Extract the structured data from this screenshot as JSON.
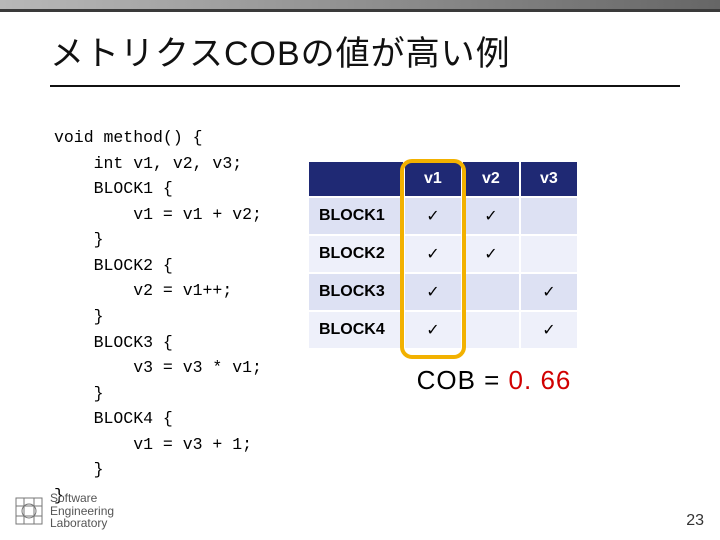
{
  "title": "メトリクスCOBの値が高い例",
  "code": "void method() {\n    int v1, v2, v3;\n    BLOCK1 {\n        v1 = v1 + v2;\n    }\n    BLOCK2 {\n        v2 = v1++;\n    }\n    BLOCK3 {\n        v3 = v3 * v1;\n    }\n    BLOCK4 {\n        v1 = v3 + 1;\n    }\n}",
  "table": {
    "headers": [
      "v1",
      "v2",
      "v3"
    ],
    "rows": [
      {
        "label": "BLOCK1",
        "cells": [
          "✓",
          "✓",
          ""
        ]
      },
      {
        "label": "BLOCK2",
        "cells": [
          "✓",
          "✓",
          ""
        ]
      },
      {
        "label": "BLOCK3",
        "cells": [
          "✓",
          "",
          "✓"
        ]
      },
      {
        "label": "BLOCK4",
        "cells": [
          "✓",
          "",
          "✓"
        ]
      }
    ]
  },
  "cob": {
    "label": "COB = ",
    "value": "0. 66"
  },
  "footer": {
    "logo_line1": "Software",
    "logo_line2": "Engineering",
    "logo_line3": "Laboratory",
    "page": "23"
  },
  "chart_data": {
    "type": "table",
    "title": "メトリクスCOBの値が高い例",
    "columns": [
      "",
      "v1",
      "v2",
      "v3"
    ],
    "rows": [
      [
        "BLOCK1",
        true,
        true,
        false
      ],
      [
        "BLOCK2",
        true,
        true,
        false
      ],
      [
        "BLOCK3",
        true,
        false,
        true
      ],
      [
        "BLOCK4",
        true,
        false,
        true
      ]
    ],
    "metric": {
      "name": "COB",
      "value": 0.66
    },
    "highlighted_column": "v1"
  }
}
